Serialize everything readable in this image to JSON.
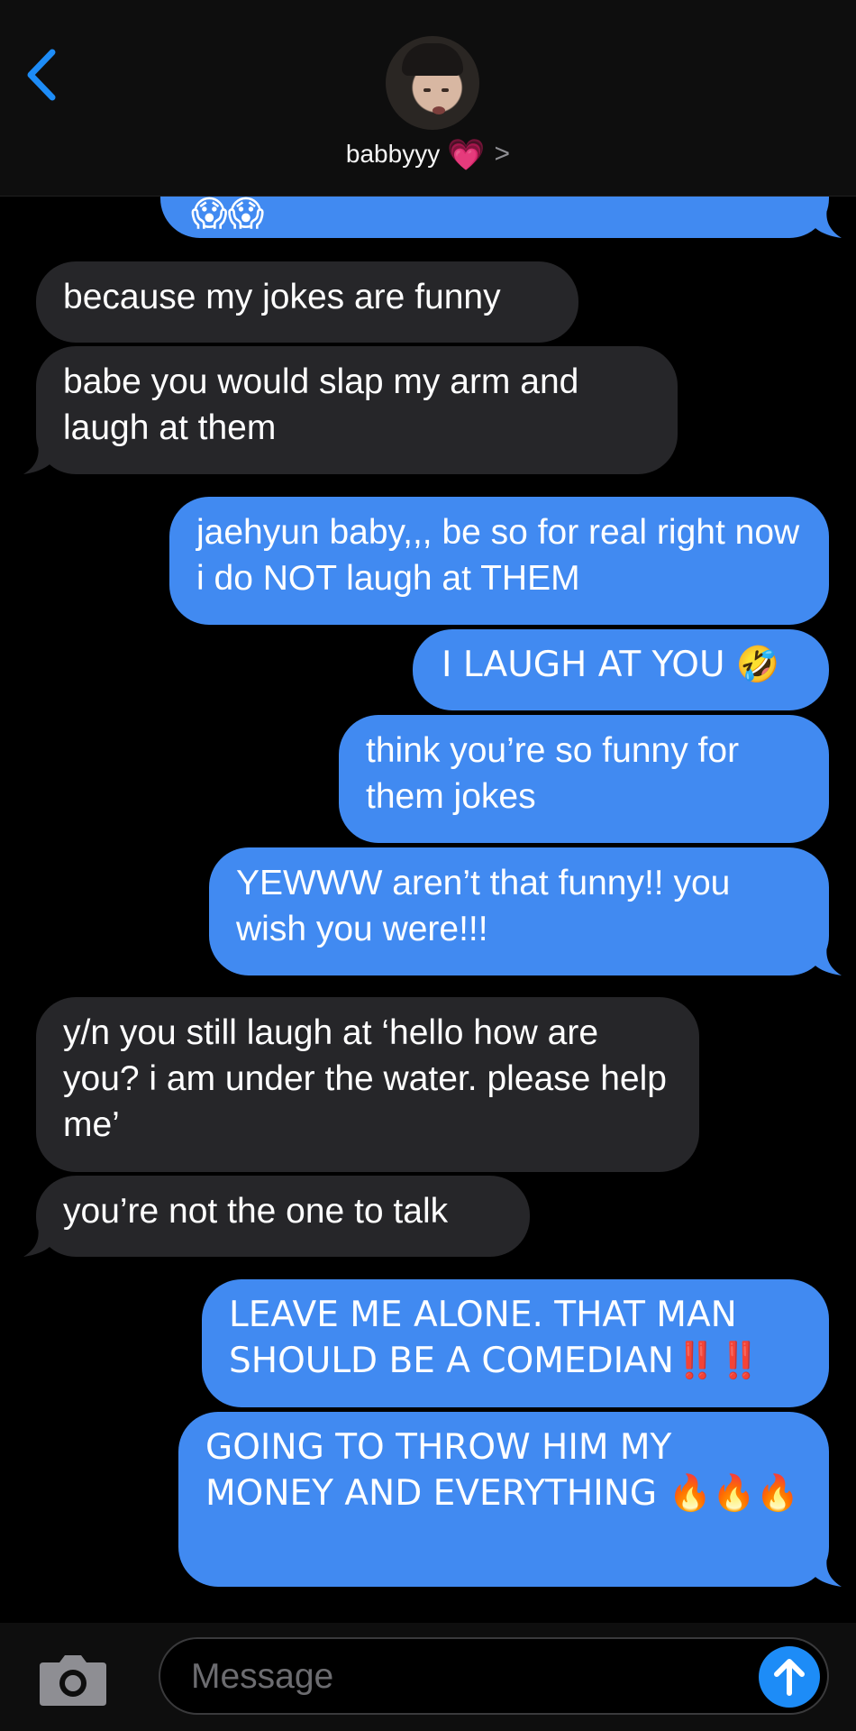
{
  "header": {
    "contact_name": "babbyyy",
    "heart": "💗",
    "chevron": ">"
  },
  "messages": [
    {
      "side": "sent",
      "text": "😱😱"
    },
    {
      "side": "received",
      "text": "because my jokes are funny"
    },
    {
      "side": "received",
      "text": "babe you would slap my arm and laugh at them"
    },
    {
      "side": "sent",
      "text": "jaehyun baby,,, be so for real right now i do NOT laugh at THEM"
    },
    {
      "side": "sent",
      "text": "I LAUGH AT YOU 🤣"
    },
    {
      "side": "sent",
      "text": "think you’re so funny for them jokes"
    },
    {
      "side": "sent",
      "text": "YEWWW aren’t that funny!! you wish you were!!!"
    },
    {
      "side": "received",
      "text": "y/n you still laugh at ‘hello how are you? i am under the water. please help me’"
    },
    {
      "side": "received",
      "text": "you’re not the one to talk"
    },
    {
      "side": "sent",
      "text": "LEAVE ME ALONE. THAT MAN SHOULD BE A COMEDIAN‼️‼️"
    },
    {
      "side": "sent",
      "text": "GOING TO THROW HIM MY MONEY AND EVERYTHING 🔥🔥🔥"
    }
  ],
  "input": {
    "placeholder": "Message"
  },
  "colors": {
    "sent_bubble": "#418af1",
    "received_bubble": "#262629",
    "accent": "#1d8cf7"
  },
  "icons": {
    "back": "chevron-left-icon",
    "camera": "camera-icon",
    "send": "arrow-up-icon"
  }
}
